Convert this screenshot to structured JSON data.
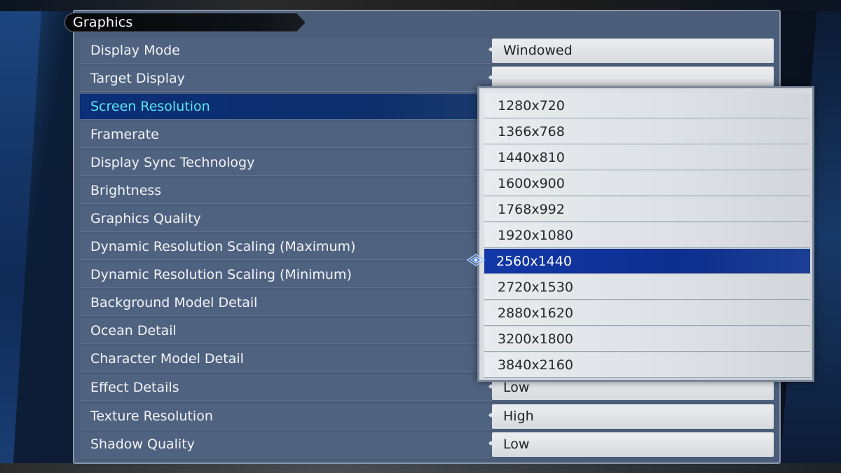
{
  "panel": {
    "title": "Graphics"
  },
  "settings": [
    {
      "label": "Display Mode",
      "value": "Windowed"
    },
    {
      "label": "Target Display",
      "value": ""
    },
    {
      "label": "Screen Resolution",
      "value": ""
    },
    {
      "label": "Framerate",
      "value": ""
    },
    {
      "label": "Display Sync Technology",
      "value": ""
    },
    {
      "label": "Brightness",
      "value": ""
    },
    {
      "label": "Graphics Quality",
      "value": ""
    },
    {
      "label": "Dynamic Resolution Scaling (Maximum)",
      "value": ""
    },
    {
      "label": "Dynamic Resolution Scaling (Minimum)",
      "value": ""
    },
    {
      "label": "Background Model Detail",
      "value": ""
    },
    {
      "label": "Ocean Detail",
      "value": ""
    },
    {
      "label": "Character Model Detail",
      "value": ""
    },
    {
      "label": "Effect Details",
      "value": "Low"
    },
    {
      "label": "Texture Resolution",
      "value": "High"
    },
    {
      "label": "Shadow Quality",
      "value": "Low"
    }
  ],
  "selected_setting": "Screen Resolution",
  "resolution_dropdown": {
    "options": [
      "1280x720",
      "1366x768",
      "1440x810",
      "1600x900",
      "1768x992",
      "1920x1080",
      "2560x1440",
      "2720x1530",
      "2880x1620",
      "3200x1800",
      "3840x2160"
    ],
    "selected": "2560x1440"
  },
  "colors": {
    "panel": "#4a5d79",
    "selected_row": "#0b2f78",
    "selected_label": "#58e6f0",
    "selected_option": "#1238a8"
  }
}
